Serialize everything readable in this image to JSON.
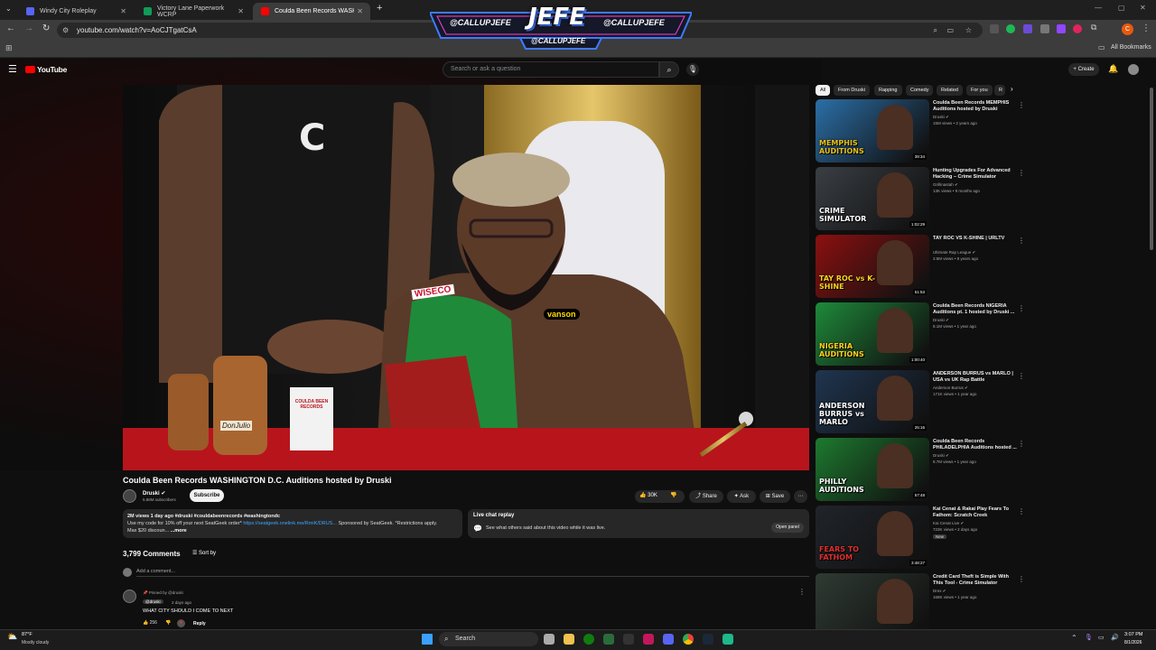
{
  "browser": {
    "tabs": [
      {
        "label": "Windy City Roleplay",
        "color": "#5865F2"
      },
      {
        "label": "Victory Lane Paperwork WCRP",
        "color": "#0F9D58"
      },
      {
        "label": "Coulda Been Records WASH",
        "color": "#FF0000"
      }
    ],
    "url": "youtube.com/watch?v=AoCJTgatCsA",
    "all_bookmarks": "All Bookmarks",
    "profile_initial": "C"
  },
  "overlay": {
    "name": "JEFE",
    "handle_left": "CALLUPJEFE",
    "handle_right": "CALLUPJEFE",
    "handle_bottom": "CALLUPJEFE"
  },
  "youtube": {
    "logo": "YouTube",
    "search_placeholder": "Search or ask a question",
    "create_label": "Create"
  },
  "video": {
    "title": "Coulda Been Records WASHINGTON D.C. Auditions hosted by Druski",
    "channel": "Druski",
    "subscribers": "5.88M subscribers",
    "subscribe_label": "Subscribe",
    "likes": "30K",
    "share_label": "Share",
    "ask_label": "Ask",
    "save_label": "Save",
    "desc_meta": "2M views  1 day ago  #druski #couldabeenrecords #washingtondc",
    "desc_line1": "Use my code for 10% off your next SeatGeek order*",
    "desc_link": "https://seatgeek.onelink.me/RmiK/DRUS...",
    "desc_line1b": "Sponsored by SeatGeek. *Restrictions apply.",
    "desc_line2": "Max $20 discoun...",
    "desc_more": "...more",
    "scene_text": {
      "cap_logo": "C",
      "jacket": "WISECO",
      "vanson": "vanson",
      "bottle": "DonJulio",
      "cup": "COULDA BEEN RECORDS"
    }
  },
  "livechat": {
    "title": "Live chat replay",
    "text": "See what others said about this video while it was live.",
    "button": "Open panel"
  },
  "comments": {
    "count": "3,799 Comments",
    "sort_label": "Sort by",
    "add_placeholder": "Add a comment...",
    "pinned_label": "Pinned by @druski",
    "author": "@druski",
    "time": "2 days ago",
    "text": "WHAT CITY SHOULD I COME TO NEXT",
    "likes": "256",
    "reply_label": "Reply"
  },
  "sidebar": {
    "chips": [
      "All",
      "From Druski",
      "Rapping",
      "Comedy",
      "Related",
      "For you",
      "R"
    ],
    "items": [
      {
        "title": "Coulda Been Records MEMPHIS Auditions hosted by Druski",
        "channel": "Druski",
        "meta": "15M views • 2 years ago",
        "duration": "39:34",
        "thumb_text": "MEMPHIS AUDITIONS",
        "bg": "#2b6fa8",
        "accent": "#e8c21b"
      },
      {
        "title": "Hunting Upgrades For Advanced Hacking – Crime Simulator",
        "channel": "Grillmastah",
        "meta": "13K views • 9 months ago",
        "duration": "1:02:29",
        "thumb_text": "CRIME SIMULATOR",
        "bg": "#3a3f44",
        "accent": "#ffffff"
      },
      {
        "title": "TAY ROC VS K-SHINE | URLTV",
        "channel": "Ultimate Rap League",
        "meta": "3.5M views • 8 years ago",
        "duration": "51:53",
        "thumb_text": "TAY ROC vs K-SHINE",
        "bg": "#8c1010",
        "accent": "#ffd21e"
      },
      {
        "title": "Coulda Been Records NIGERIA Auditions pt. 1 hosted by Druski ...",
        "channel": "Druski",
        "meta": "8.1M views • 1 year ago",
        "duration": "1:00:40",
        "thumb_text": "NIGERIA AUDITIONS",
        "bg": "#1e8a3a",
        "accent": "#ffd21e"
      },
      {
        "title": "ANDERSON BURRUS vs MARLO | USA vs UK Rap Battle",
        "channel": "Anderson Burrus",
        "meta": "171K views • 1 year ago",
        "duration": "25:16",
        "thumb_text": "ANDERSON BURRUS vs MARLO",
        "bg": "#1f3550",
        "accent": "#ffffff"
      },
      {
        "title": "Coulda Been Records PHILADELPHIA Auditions hosted ...",
        "channel": "Druski",
        "meta": "8.7M views • 1 year ago",
        "duration": "57:48",
        "thumb_text": "PHILLY AUDITIONS",
        "bg": "#1d7a2f",
        "accent": "#ffffff"
      },
      {
        "title": "Kai Cenat & Rakai Play Fears To Fathom: Scratch Creek",
        "channel": "Kai Cenat Live",
        "meta": "723K views • 2 days ago",
        "duration": "3:48:27",
        "badge": "New",
        "thumb_text": "FEARS TO FATHOM",
        "bg": "#20242a",
        "accent": "#e03030"
      },
      {
        "title": "Credit Card Theft is Simple With This Tool - Crime Simulator",
        "channel": "Drex",
        "meta": "168K views • 1 year ago",
        "duration": "",
        "thumb_text": "",
        "bg": "#2f3b33",
        "accent": "#3ad06a"
      }
    ]
  },
  "taskbar": {
    "weather_temp": "87°F",
    "weather_desc": "Mostly cloudy",
    "search_label": "Search",
    "time": "3:07 PM",
    "date": "8/1/2026"
  },
  "colors": {
    "accent": "#ff0000",
    "bg": "#0f0f0f",
    "chip": "#272727"
  }
}
